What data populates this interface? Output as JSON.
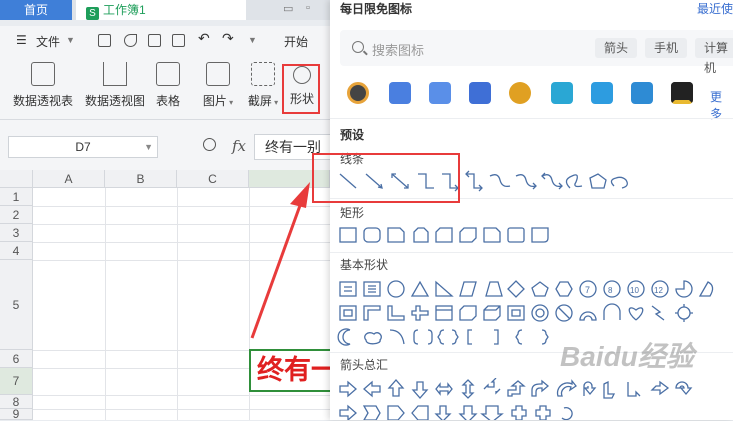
{
  "tabs": {
    "home": "首页",
    "document": "工作簿1"
  },
  "menubar": {
    "file_label": "文件",
    "start_label": "开始"
  },
  "ribbon": {
    "pivot_table": "数据透视表",
    "pivot_chart": "数据透视图",
    "table": "表格",
    "picture": "图片",
    "screenshot": "截屏",
    "shape": "形状"
  },
  "formula_bar": {
    "cell_ref": "D7",
    "fx": "fx",
    "content": "终有一别"
  },
  "grid": {
    "columns": [
      "A",
      "B",
      "C"
    ],
    "rows": [
      "1",
      "2",
      "3",
      "4",
      "5",
      "6",
      "7",
      "8",
      "9"
    ],
    "selected_cell_text": "终有一别"
  },
  "panel": {
    "title": "每日限免图标",
    "recent_link": "最近使",
    "search_placeholder": "搜索图标",
    "chips": [
      "箭头",
      "手机",
      "计算机"
    ],
    "more_link": "更多",
    "preset_title": "预设",
    "categories": [
      "线条",
      "矩形",
      "基本形状",
      "箭头总汇"
    ],
    "icon_colors": [
      "#e7a33a",
      "#4a7fe0",
      "#5a8fe8",
      "#3f6fd6",
      "#e0a022",
      "#2aa7d4",
      "#2d9ce0",
      "#2e8bd4",
      "#e9b930"
    ]
  },
  "watermark": "Baidu经验"
}
